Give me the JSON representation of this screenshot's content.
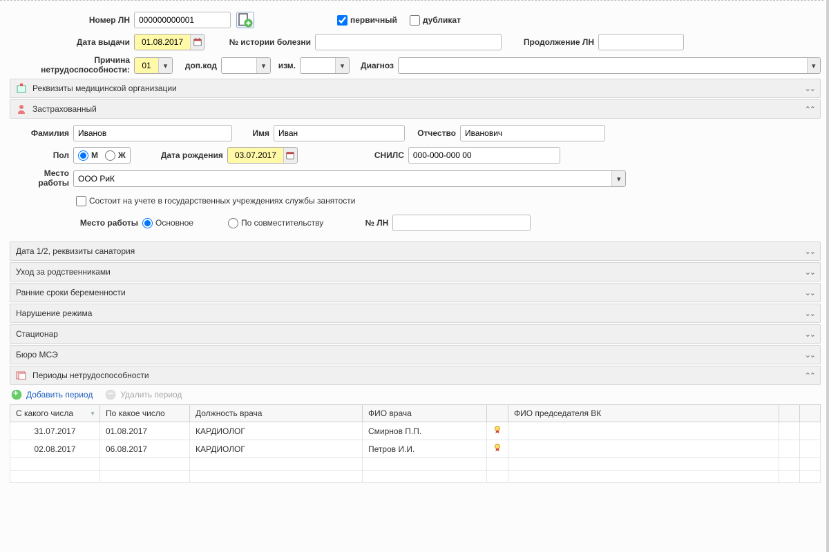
{
  "top": {
    "number_label": "Номер ЛН",
    "number_value": "000000000001",
    "primary_label": "первичный",
    "duplicate_label": "дубликат",
    "issue_date_label": "Дата выдачи",
    "issue_date_value": "01.08.2017",
    "history_label": "№ истории болезни",
    "continuation_label": "Продолжение ЛН",
    "reason_label1": "Причина",
    "reason_label2": "нетрудоспособности:",
    "reason_value": "01",
    "addcode_label": "доп.код",
    "change_label": "изм.",
    "diagnosis_label": "Диагноз"
  },
  "sections": {
    "org": "Реквизиты медицинской организации",
    "insured": "Застрахованный",
    "sanatorium": "Дата 1/2, реквизиты санатория",
    "relatives": "Уход за родственниками",
    "pregnancy": "Ранние сроки беременности",
    "violation": "Нарушение режима",
    "hospital": "Стационар",
    "mse": "Бюро МСЭ",
    "periods": "Периоды нетрудоспособности"
  },
  "insured": {
    "surname_label": "Фамилия",
    "surname_value": "Иванов",
    "name_label": "Имя",
    "name_value": "Иван",
    "patronymic_label": "Отчество",
    "patronymic_value": "Иванович",
    "sex_label": "Пол",
    "sex_m": "М",
    "sex_f": "Ж",
    "dob_label": "Дата рождения",
    "dob_value": "03.07.2017",
    "snils_label": "СНИЛС",
    "snils_value": "000-000-000 00",
    "workplace_label": "Место",
    "workplace_label2": "работы",
    "workplace_value": "ООО РиК",
    "registered_label": "Состоит на учете в государственных учреждениях службы занятости",
    "workplace_type_label": "Место работы",
    "main_label": "Основное",
    "secondary_label": "По совместительству",
    "ln_no_label": "№ ЛН"
  },
  "periods": {
    "add": "Добавить период",
    "delete": "Удалить период",
    "col_from": "С какого числа",
    "col_to": "По какое число",
    "col_position": "Должность врача",
    "col_doctor": "ФИО врача",
    "col_chairman": "ФИО председателя ВК",
    "rows": [
      {
        "from": "31.07.2017",
        "to": "01.08.2017",
        "position": "КАРДИОЛОГ",
        "doctor": "Смирнов П.П."
      },
      {
        "from": "02.08.2017",
        "to": "06.08.2017",
        "position": "КАРДИОЛОГ",
        "doctor": "Петров И.И."
      }
    ]
  }
}
